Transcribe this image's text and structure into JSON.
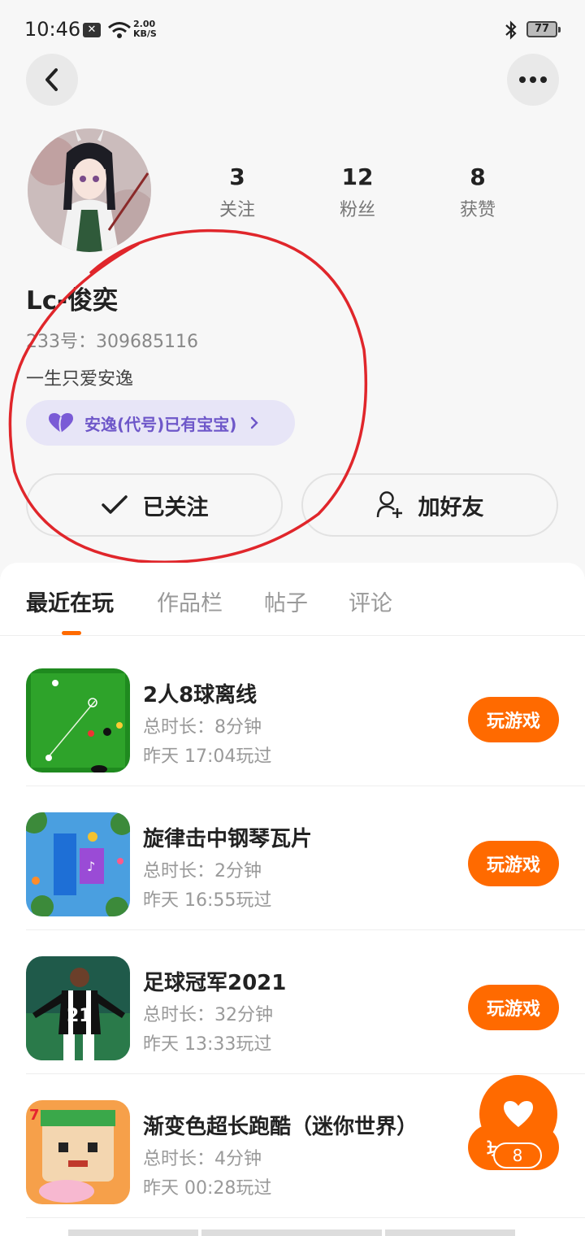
{
  "status_bar": {
    "time": "10:46",
    "network_speed_value": "2.00",
    "network_speed_unit": "KB/S",
    "battery": "77",
    "icons": [
      "close-notification-icon",
      "wifi-icon",
      "bluetooth-icon",
      "battery-icon"
    ]
  },
  "header": {
    "back_icon": "chevron-left-icon",
    "more_icon": "more-dots-icon"
  },
  "profile": {
    "stats": [
      {
        "value": "3",
        "label": "关注"
      },
      {
        "value": "12",
        "label": "粉丝"
      },
      {
        "value": "8",
        "label": "获赞"
      }
    ],
    "name": "Lc-俊奕",
    "id_label": "233号：309685116",
    "bio": "一生只爱安逸",
    "badge_label": "安逸(代号)已有宝宝)",
    "follow_button": "已关注",
    "add_friend_button": "加好友"
  },
  "tabs": [
    {
      "label": "最近在玩",
      "active": true
    },
    {
      "label": "作品栏",
      "active": false
    },
    {
      "label": "帖子",
      "active": false
    },
    {
      "label": "评论",
      "active": false
    }
  ],
  "games": [
    {
      "title": "2人8球离线",
      "duration": "总时长：8分钟",
      "last_played": "昨天 17:04玩过",
      "button": "玩游戏"
    },
    {
      "title": "旋律击中钢琴瓦片",
      "duration": "总时长：2分钟",
      "last_played": "昨天 16:55玩过",
      "button": "玩游戏"
    },
    {
      "title": "足球冠军2021",
      "duration": "总时长：32分钟",
      "last_played": "昨天 13:33玩过",
      "button": "玩游戏"
    },
    {
      "title": "渐变色超长跑酷（迷你世界）",
      "duration": "总时长：4分钟",
      "last_played": "昨天 00:28玩过",
      "button": "玩游戏"
    }
  ],
  "like_fab": {
    "count": "8"
  },
  "colors": {
    "accent": "#ff6a00",
    "badge_bg": "#e7e5f7",
    "badge_text": "#6e57c9",
    "annotation": "#e0262b"
  }
}
